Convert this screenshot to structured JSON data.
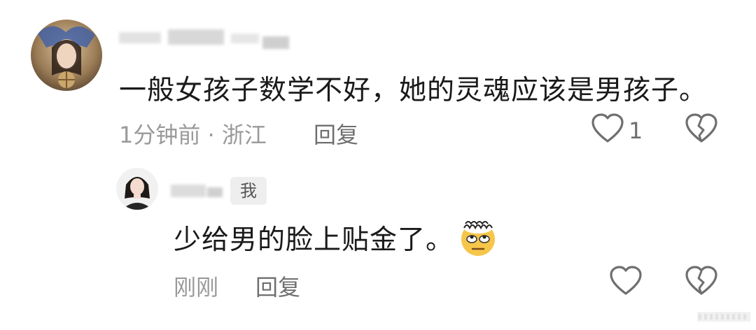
{
  "comments": [
    {
      "username": "",
      "text": "一般女孩子数学不好，她的灵魂应该是男孩子。",
      "time": "1分钟前",
      "location": "浙江",
      "meta": "1分钟前 · 浙江",
      "reply_label": "回复",
      "like_count": "1",
      "avatar_icon": "user-avatar-photo"
    },
    {
      "username": "",
      "badge": "我",
      "text": "少给男的脸上贴金了。",
      "emoji_icon": "face-with-spiral-hair-eye-roll-emoji",
      "time": "刚刚",
      "reply_label": "回复",
      "avatar_icon": "user-avatar-photo"
    }
  ],
  "colors": {
    "primary_text": "#1a1a1a",
    "secondary_text": "#9a9a9a",
    "action_text": "#6f6f6f",
    "badge_bg": "#eeeeee"
  }
}
